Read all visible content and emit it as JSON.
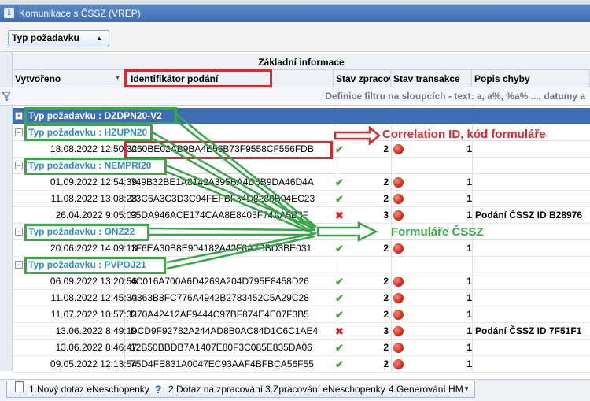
{
  "window": {
    "title": "Komunikace s ČSSZ (VREP)",
    "info_icon": "info-icon"
  },
  "group_by": {
    "label": "Typ požadavku"
  },
  "band_header": "Základní informace",
  "columns": {
    "created": "Vytvořeno",
    "identifier": "Identifikátor podání",
    "processing_state": "Stav zpracování",
    "transaction_state": "Stav transakce",
    "error_description": "Popis chyby"
  },
  "filter_hint": "Definice filtru na sloupcích - text: a, a%, %a% ..., datumy a",
  "groups": [
    {
      "label": "Typ požadavku : DZDPN20-V2",
      "expanded": false,
      "selected": true,
      "rows": []
    },
    {
      "label": "Typ požadavku : HZUPN20",
      "expanded": true,
      "rows": [
        {
          "date": "18.08.2022 12:50:32",
          "id": "A60BE02AB9BA4E56B73F9558CF556FDB",
          "status": "ok",
          "n1": "2",
          "n2": "1",
          "error": ""
        }
      ]
    },
    {
      "label": "Typ požadavku : NEMPRI20",
      "expanded": true,
      "rows": [
        {
          "date": "01.09.2022 12:54:39",
          "id": "749B32BE1A8142A395BA4D5B9DA46D4A",
          "status": "ok",
          "n1": "2",
          "n2": "1",
          "error": ""
        },
        {
          "date": "11.08.2022 13:08:28",
          "id": "23C6A3C3D3C94FEFBF34D8280B04EC23",
          "status": "ok",
          "n1": "2",
          "n2": "1",
          "error": ""
        },
        {
          "date": "26.04.2022 9:05:03",
          "id": "95DA946ACE174CAA8E8405F74AA5B3F",
          "status": "error",
          "n1": "3",
          "n2": "1",
          "error": "Podání ČSSZ ID B28976"
        }
      ]
    },
    {
      "label": "Typ požadavku : ONZ22",
      "expanded": true,
      "rows": [
        {
          "date": "20.06.2022 14:09:13",
          "id": "1F6EA30B8E904182A42F8A7BBD3BE031",
          "status": "ok",
          "n1": "2",
          "n2": "1",
          "error": ""
        }
      ]
    },
    {
      "label": "Typ požadavku : PVPOJ21",
      "expanded": true,
      "rows": [
        {
          "date": "06.09.2022 13:20:56",
          "id": "4C016A700A6D4269A204D795E8458D26",
          "status": "ok",
          "n1": "2",
          "n2": "1",
          "error": ""
        },
        {
          "date": "11.08.2022 12:45:30",
          "id": "A363B8FC776A4942B2783452C5A29C28",
          "status": "ok",
          "n1": "2",
          "n2": "1",
          "error": ""
        },
        {
          "date": "11.07.2022 10:57:32",
          "id": "B70A42412AF9444C97BF874E4E07F3B5",
          "status": "ok",
          "n1": "2",
          "n2": "1",
          "error": ""
        },
        {
          "date": "13.06.2022 8:49:19",
          "id": "DCD9F92782A244AD8B0AC84D1C6C1AE4",
          "status": "error",
          "n1": "3",
          "n2": "1",
          "error": "Podání ČSSZ ID 7F51F1"
        },
        {
          "date": "13.06.2022 8:46:47",
          "id": "12B50BBDB7A1407E80F3C085E835DA06",
          "status": "ok",
          "n1": "2",
          "n2": "1",
          "error": ""
        },
        {
          "date": "09.05.2022 12:13:54",
          "id": "75D4FE831A0047EC93AAF4BFBCA56F55",
          "status": "ok",
          "n1": "2",
          "n2": "1",
          "error": ""
        }
      ]
    }
  ],
  "annotations": {
    "correlation": "Correlation ID, kód formuláře",
    "forms": "Formuláře ČSSZ"
  },
  "bottom_tabs": {
    "tab1": "1.Nový dotaz eNeschopenky",
    "tab2": "2.Dotaz na zpracování",
    "tab3": "3.Zpracování eNeschopenky",
    "tab4": "4.Generování HM"
  },
  "colors": {
    "accent_red": "#e0262f",
    "accent_green": "#3aa64a",
    "selected_row": "#3d6eb4",
    "group_text": "#2f8ec4"
  }
}
